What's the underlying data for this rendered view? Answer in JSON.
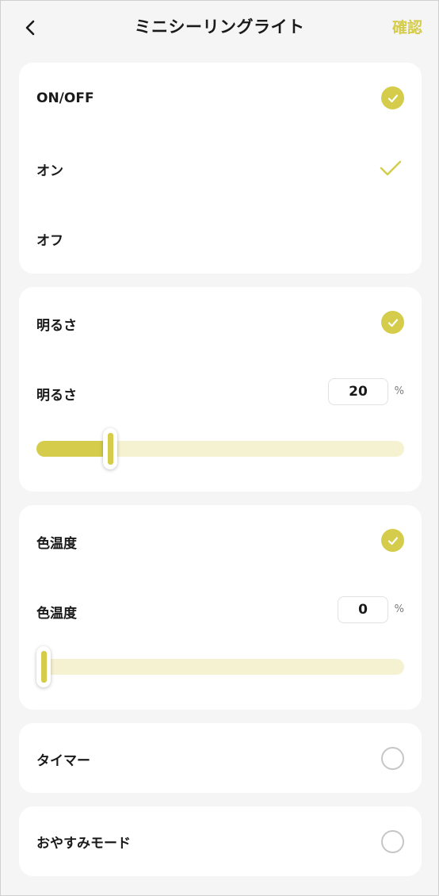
{
  "colors": {
    "accent": "#d4cc4a",
    "track": "#f5f2d2",
    "text": "#1a1a1a",
    "background": "#f5f5f5",
    "card": "#ffffff"
  },
  "header": {
    "back_icon": "chevron-left-icon",
    "title": "ミニシーリングライト",
    "confirm_label": "確認"
  },
  "power": {
    "title": "ON/OFF",
    "selected": true,
    "options": [
      {
        "label": "オン",
        "selected": true
      },
      {
        "label": "オフ",
        "selected": false
      }
    ]
  },
  "brightness": {
    "title": "明るさ",
    "selected": true,
    "row_label": "明るさ",
    "value": "20",
    "unit": "%",
    "slider_fraction": 0.2
  },
  "color_temperature": {
    "title": "色温度",
    "selected": true,
    "row_label": "色温度",
    "value": "0",
    "unit": "%",
    "slider_fraction": 0.0
  },
  "timer": {
    "label": "タイマー",
    "selected": false
  },
  "sleep_mode": {
    "label": "おやすみモード",
    "selected": false
  }
}
